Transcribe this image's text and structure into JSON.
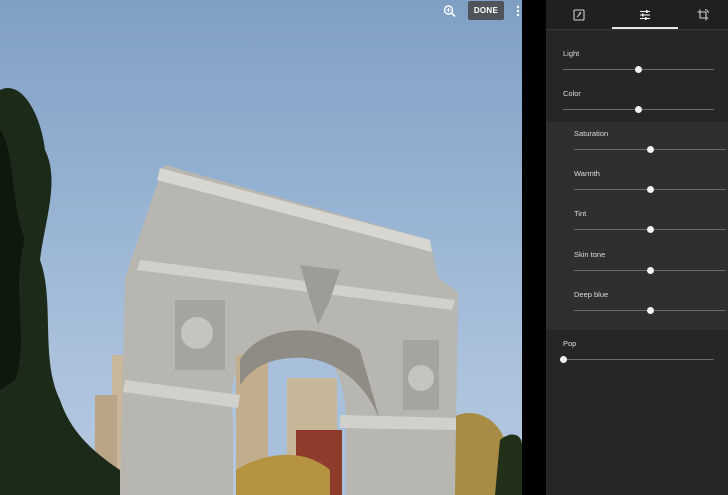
{
  "toolbar": {
    "zoom_icon": "zoom-in-icon",
    "done_label": "DONE",
    "more_icon": "more-vert-icon"
  },
  "panel": {
    "tabs": [
      {
        "icon": "auto-enhance-icon",
        "active": false
      },
      {
        "icon": "tune-icon",
        "active": true
      },
      {
        "icon": "crop-rotate-icon",
        "active": false
      }
    ],
    "main_sliders": [
      {
        "label": "Light",
        "value": 0.5
      },
      {
        "label": "Color",
        "value": 0.5
      }
    ],
    "color_sub_sliders": [
      {
        "label": "Saturation",
        "value": 0.5
      },
      {
        "label": "Warmth",
        "value": 0.5
      },
      {
        "label": "Tint",
        "value": 0.5
      },
      {
        "label": "Skin tone",
        "value": 0.5
      },
      {
        "label": "Deep blue",
        "value": 0.5
      }
    ],
    "pop_slider": {
      "label": "Pop",
      "value": 0.0
    }
  },
  "colors": {
    "panel_bg": "#2a2a2a",
    "accent": "#e6e6e6"
  }
}
